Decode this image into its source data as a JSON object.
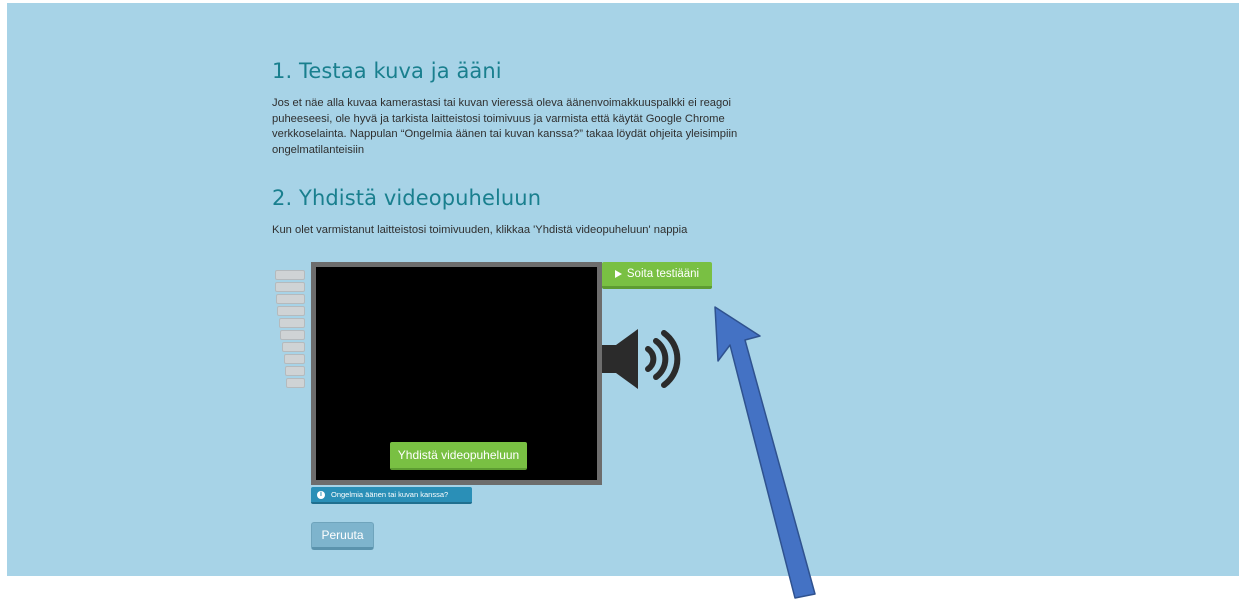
{
  "section1": {
    "title": "1. Testaa kuva ja ääni",
    "text": "Jos et näe alla kuvaa kamerastasi tai kuvan vieressä oleva äänenvoimakkuuspalkki ei reagoi puheeseesi, ole hyvä ja tarkista laitteistosi toimivuus ja varmista että käytät Google Chrome verkkoselainta. Nappulan “Ongelmia äänen tai kuvan kanssa?” takaa löydät ohjeita yleisimpiin ongelmatilanteisiin"
  },
  "section2": {
    "title": "2. Yhdistä videopuheluun",
    "text": "Kun olet varmistanut laitteistosi toimivuuden, klikkaa 'Yhdistä videopuheluun' nappia"
  },
  "buttons": {
    "play_test_sound": "Soita testiääni",
    "connect_video_call": "Yhdistä videopuheluun",
    "help": "Ongelmia äänen tai kuvan kanssa?",
    "cancel": "Peruuta"
  },
  "icons": {
    "play": "play-icon",
    "speaker": "speaker-icon",
    "info": "info-icon",
    "annotation_arrow": "arrow-icon"
  },
  "colors": {
    "panel_bg": "#a7d3e7",
    "heading": "#197f8e",
    "green_button": "#79c043",
    "blue_button": "#2a8fb7",
    "cancel_button": "#7eb4cd",
    "arrow_fill": "#4472c4"
  },
  "audio_meter": {
    "level": 0
  }
}
